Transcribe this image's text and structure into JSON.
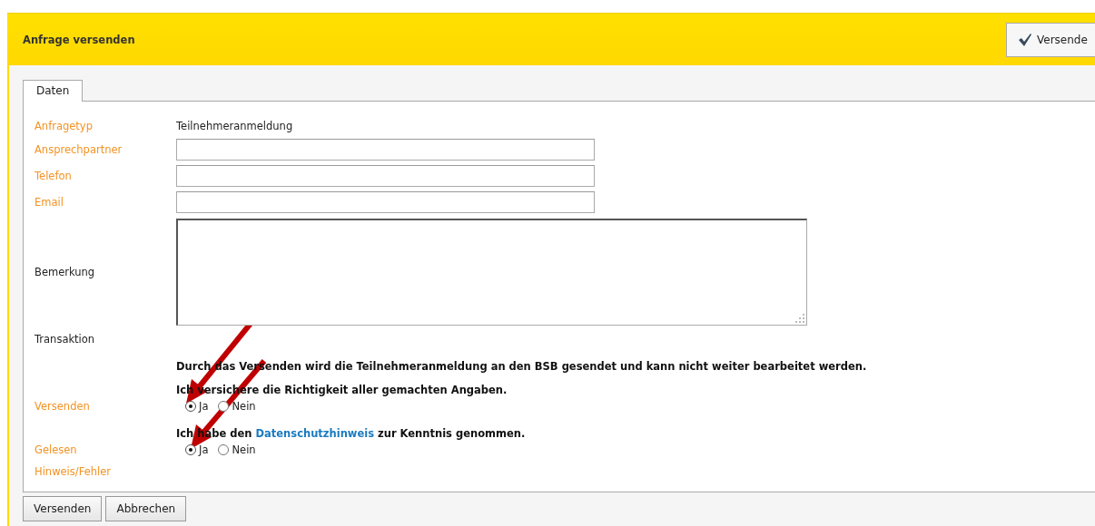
{
  "header": {
    "title": "Anfrage versenden",
    "button": "Versende"
  },
  "tabs": [
    {
      "label": "Daten",
      "selected": true
    }
  ],
  "rows": [
    {
      "kind": "text",
      "label": "Anfragetyp",
      "color": "#f39325",
      "value": "Teilnehmeranmeldung"
    },
    {
      "kind": "input",
      "label": "Ansprechpartner",
      "color": "#f39325"
    },
    {
      "kind": "input",
      "label": "Telefon",
      "color": "#f39325"
    },
    {
      "kind": "input",
      "label": "Email",
      "color": "#f39325"
    },
    {
      "kind": "textarea",
      "label": "Bemerkung",
      "color": "#222222"
    },
    {
      "kind": "label",
      "label": "Transaktion",
      "color": "#222222"
    },
    {
      "kind": "note",
      "text": "Durch das Versenden wird die Teilnehmeranmeldung an den BSB gesendet und kann nicht weiter bearbeitet werden."
    },
    {
      "kind": "note",
      "text": "Ich versichere die Richtigkeit aller gemachten Angaben."
    },
    {
      "kind": "radio",
      "label": "Versenden",
      "color": "#f39325",
      "options": [
        {
          "label": "Ja",
          "selected": true
        },
        {
          "label": "Nein",
          "selected": false
        }
      ]
    },
    {
      "kind": "note",
      "text": "Ich habe den ",
      "link": "Datenschutzhinweis",
      "after": " zur Kenntnis genommen."
    },
    {
      "kind": "radio",
      "label": "Gelesen",
      "color": "#f39325",
      "options": [
        {
          "label": "Ja",
          "selected": true
        },
        {
          "label": "Nein",
          "selected": false
        }
      ]
    },
    {
      "kind": "label",
      "label": "Hinweis/Fehler",
      "color": "#f39325"
    }
  ],
  "buttons": [
    "Versenden",
    "Abbrechen"
  ]
}
